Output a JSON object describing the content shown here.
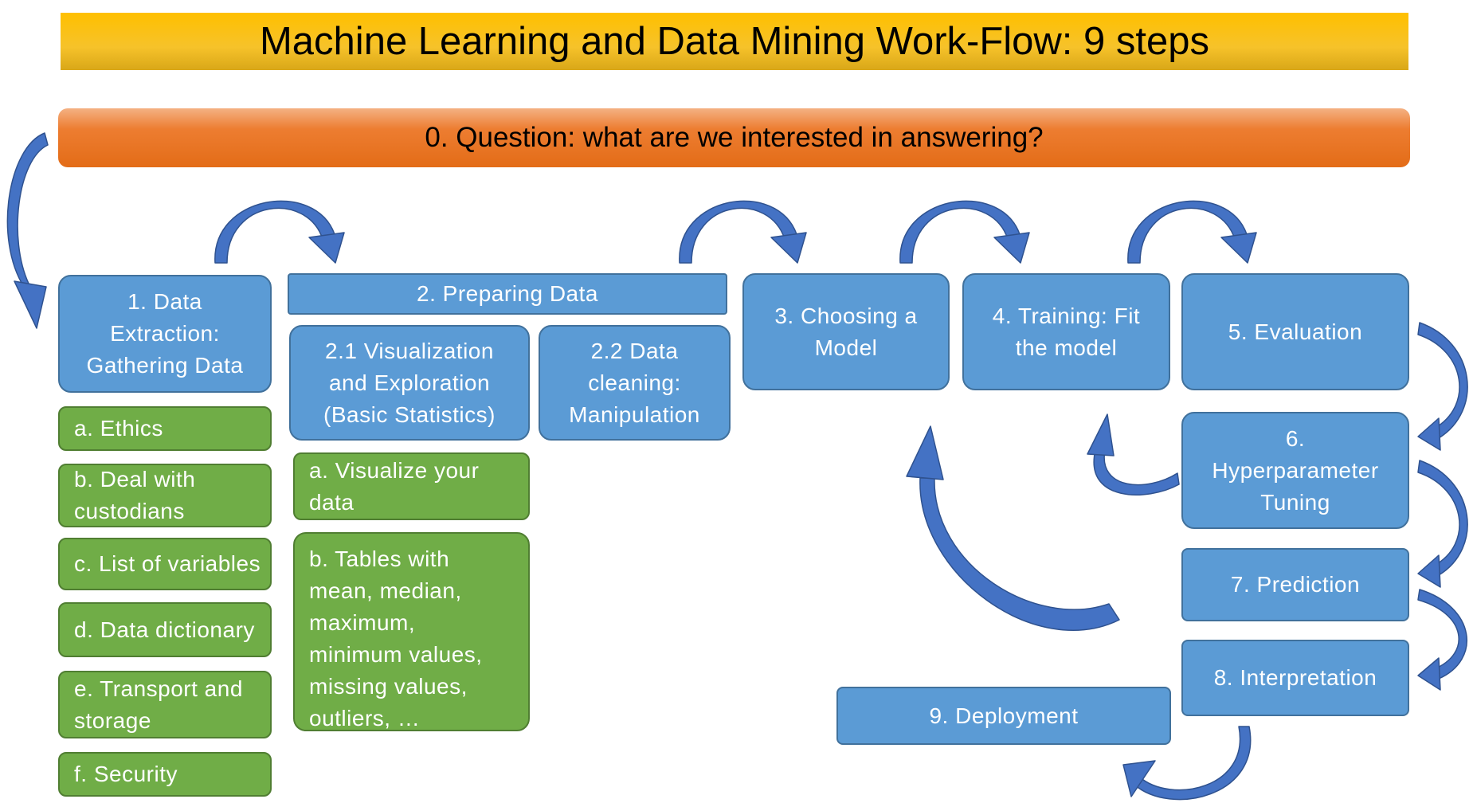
{
  "title": "Machine Learning and Data Mining Work-Flow: 9 steps",
  "question": "0. Question: what are we interested in answering?",
  "steps": {
    "step1": "1. Data\nExtraction:\nGathering Data",
    "step2": "2. Preparing Data",
    "step2_1": "2.1 Visualization\nand Exploration\n(Basic Statistics)",
    "step2_2": "2.2 Data\ncleaning:\nManipulation",
    "step3": "3. Choosing a\nModel",
    "step4": "4. Training: Fit\nthe model",
    "step5": "5. Evaluation",
    "step6": "6.\nHyperparameter\nTuning",
    "step7": "7. Prediction",
    "step8": "8. Interpretation",
    "step9": "9. Deployment"
  },
  "extraction_items": [
    "a. Ethics",
    "b. Deal with\ncustodians",
    "c. List of variables",
    "d. Data dictionary",
    "e. Transport and\nstorage",
    "f. Security"
  ],
  "exploration_items": [
    "a. Visualize your\ndata",
    "b. Tables with\nmean, median,\nmaximum,\nminimum values,\nmissing values,\noutliers, …"
  ],
  "colors": {
    "title_fill": "#ffc000",
    "question_fill": "#ed7d31",
    "step_fill": "#5b9bd5",
    "substep_fill": "#70ad47",
    "arrow_fill": "#4472c4"
  }
}
